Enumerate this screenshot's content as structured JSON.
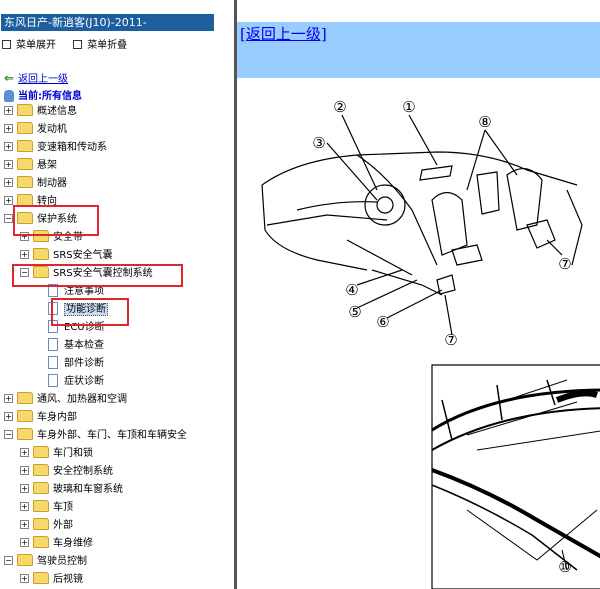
{
  "sidebar": {
    "title": "东风日产-新逍客(J10)-2011-",
    "menu": {
      "expand_label": "菜单展开",
      "collapse_label": "菜单折叠"
    },
    "back_label": "返回上一级",
    "current_label": "当前:所有信息",
    "tree": [
      {
        "label": "概述信息",
        "icon": "folder",
        "expander": "+"
      },
      {
        "label": "发动机",
        "icon": "folder",
        "expander": "+"
      },
      {
        "label": "变速箱和传动系",
        "icon": "folder",
        "expander": "+"
      },
      {
        "label": "悬架",
        "icon": "folder",
        "expander": "+"
      },
      {
        "label": "制动器",
        "icon": "folder",
        "expander": "+"
      },
      {
        "label": "转向",
        "icon": "folder",
        "expander": "+"
      },
      {
        "label": "保护系统",
        "icon": "folder",
        "expander": "−"
      },
      {
        "label": "安全带",
        "icon": "folder",
        "expander": "+"
      },
      {
        "label": "SRS安全气囊",
        "icon": "folder",
        "expander": "+"
      },
      {
        "label": "SRS安全气囊控制系统",
        "icon": "folder",
        "expander": "−"
      },
      {
        "label": "注意事项",
        "icon": "doc"
      },
      {
        "label": "功能诊断",
        "icon": "doc",
        "selected": true
      },
      {
        "label": "ECU诊断",
        "icon": "doc"
      },
      {
        "label": "基本检查",
        "icon": "doc"
      },
      {
        "label": "部件诊断",
        "icon": "doc"
      },
      {
        "label": "症状诊断",
        "icon": "doc"
      },
      {
        "label": "通风、加热器和空调",
        "icon": "folder",
        "expander": "+"
      },
      {
        "label": "车身内部",
        "icon": "folder",
        "expander": "+"
      },
      {
        "label": "车身外部、车门、车顶和车辆安全",
        "icon": "folder",
        "expander": "−"
      },
      {
        "label": "车门和锁",
        "icon": "folder",
        "expander": "+"
      },
      {
        "label": "安全控制系统",
        "icon": "folder",
        "expander": "+"
      },
      {
        "label": "玻璃和车窗系统",
        "icon": "folder",
        "expander": "+"
      },
      {
        "label": "车顶",
        "icon": "folder",
        "expander": "+"
      },
      {
        "label": "外部",
        "icon": "folder",
        "expander": "+"
      },
      {
        "label": "车身维修",
        "icon": "folder",
        "expander": "+"
      },
      {
        "label": "驾驶员控制",
        "icon": "folder",
        "expander": "−"
      },
      {
        "label": "后视镜",
        "icon": "folder",
        "expander": "+"
      }
    ]
  },
  "content": {
    "back_link": "[返回上一级]",
    "callouts": [
      "①",
      "②",
      "③",
      "④",
      "⑤",
      "⑥",
      "⑦",
      "⑧",
      "⑩"
    ]
  },
  "colors": {
    "title_bg": "#1d5e9e",
    "top_bar": "#99ccff",
    "highlight_box": "#e0262d",
    "link": "#0000ee"
  }
}
